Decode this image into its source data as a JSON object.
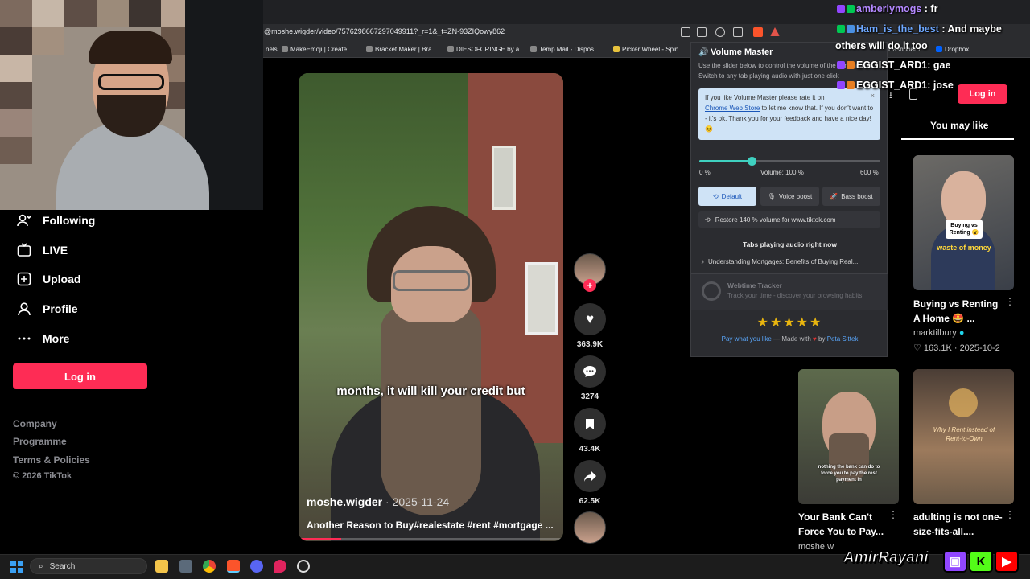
{
  "browser": {
    "url": "@moshe.wigder/video/7576298667297049911?_r=1&_t=ZN-93ZIQowy862",
    "bookmarks": [
      "nels",
      "MakeEmoji | Create...",
      "Bracket Maker | Bra...",
      "DIESOFCRINGE by a...",
      "Temp Mail - Dispos...",
      "Picker Wheel - Spin...",
      "Dashboard",
      "Dropbox"
    ]
  },
  "sidebar": {
    "items": [
      {
        "label": "Following",
        "icon": "following-icon"
      },
      {
        "label": "LIVE",
        "icon": "live-icon"
      },
      {
        "label": "Upload",
        "icon": "upload-icon"
      },
      {
        "label": "Profile",
        "icon": "profile-icon"
      },
      {
        "label": "More",
        "icon": "more-icon"
      }
    ],
    "login_label": "Log in",
    "footer": [
      "Company",
      "Programme",
      "Terms & Policies",
      "© 2026 TikTok"
    ]
  },
  "video": {
    "caption": "months, it will kill your credit but",
    "username": "moshe.wigder",
    "date": "· 2025-11-24",
    "description": "Another Reason to Buy#realestate #rent #mortgage ...",
    "progress": 0.16
  },
  "actions": {
    "likes": "363.9K",
    "comments": "3274",
    "saves": "43.4K",
    "shares": "62.5K"
  },
  "volume_master": {
    "title": "Volume Master",
    "subtitle": "Use the slider below to control the volume of the current tab. Switch to any tab playing audio with just one click",
    "rate_text_1": "If you like Volume Master please rate it on",
    "rate_link": "Chrome Web Store",
    "rate_text_2": "to let me know that. If you don't want to - it's ok. Thank you for your feedback and have a nice day! 😊",
    "close": "×",
    "slider_min": "0 %",
    "slider_max": "600 %",
    "volume_label": "Volume: 100 %",
    "volume_fraction": 0.29,
    "btn_default": "Default",
    "btn_voice": "Voice boost",
    "btn_bass": "Bass boost",
    "restore": "Restore 140 % volume for www.tiktok.com",
    "tabs_heading": "Tabs playing audio right now",
    "tab_item": "Understanding Mortgages: Benefits of Buying Real...",
    "webtime_title": "Webtime Tracker",
    "webtime_sub": "Track your time - discover your browsing habits!",
    "stars": "★★★★★",
    "pay_what": "Pay what you like",
    "made_with": "— Made with",
    "by": "by",
    "author": "Peta Sittek"
  },
  "right": {
    "login_label": "Log in",
    "you_may_like": "You may like",
    "cards": [
      {
        "title": "Buying vs Renting A Home 🤩 ...",
        "author": "marktilbury",
        "likes": "♡ 163.1K",
        "date": "· 2025-10-2",
        "thumb_text": "Buying vs Renting 😮",
        "thumb_sub": "waste of money"
      },
      {
        "title": "Your Bank Can't Force You to Pay...",
        "author": "moshe.w",
        "likes": "",
        "date": "",
        "thumb_text": "nothing the bank can do to force you to pay the rest payment in"
      },
      {
        "title": "adulting is not one-size-fits-all....",
        "author": "",
        "likes": "",
        "date": "",
        "thumb_text": "Why I Rent instead of Rent-to-Own"
      }
    ]
  },
  "chat": [
    {
      "name": "amberlymogs",
      "msg": ": fr"
    },
    {
      "name": "Ham_is_the_best",
      "msg": ": And maybe"
    },
    {
      "name": "",
      "msg": "others will do it too"
    },
    {
      "name": "EGGIST_ARD1",
      "msg": ": gae"
    },
    {
      "name": "EGGIST_ARD1",
      "msg": ": jose"
    }
  ],
  "taskbar": {
    "search": "Search"
  },
  "brand": {
    "name": "AmirRayani"
  },
  "colors": {
    "accent": "#fe2c55",
    "slider": "#3fd1c0",
    "link": "#5aa9ff"
  }
}
